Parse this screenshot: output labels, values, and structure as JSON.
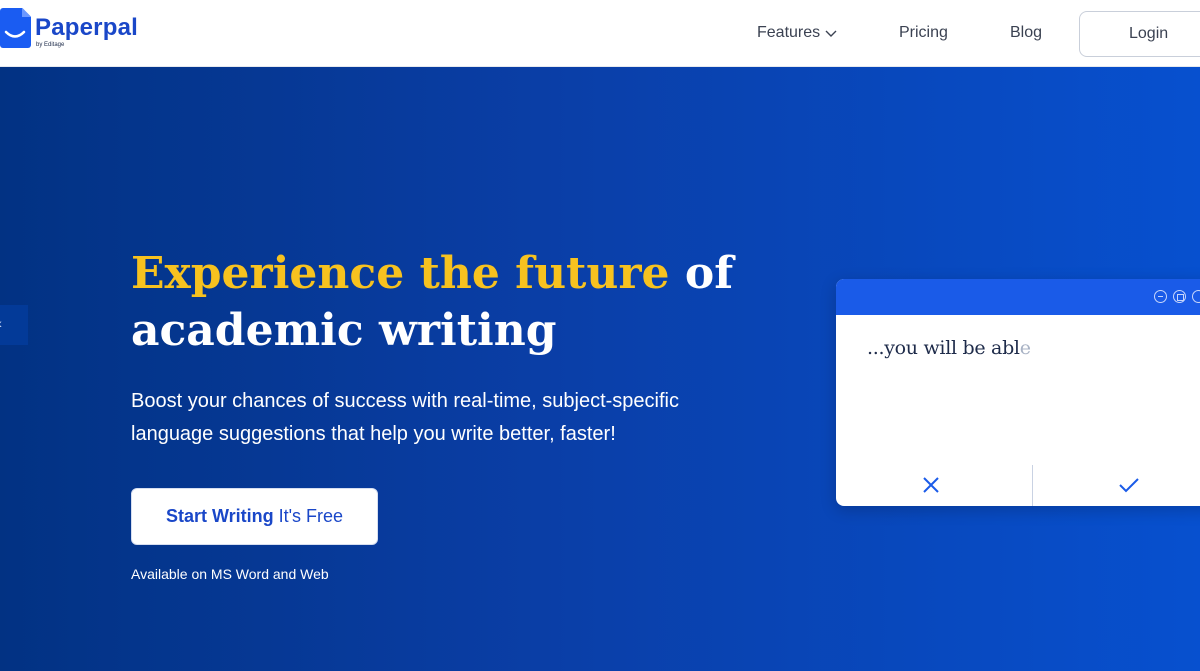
{
  "brand": {
    "name": "Paperpal",
    "tagline": "by Editage",
    "color": "#1a5cf2"
  },
  "nav": {
    "features": "Features",
    "pricing": "Pricing",
    "blog": "Blog",
    "login": "Login"
  },
  "hero": {
    "headline_highlight": "Experience the future",
    "headline_rest": " of academic writing",
    "subtext": "Boost your chances of success with real-time, subject-specific language suggestions that help you write better, faster!",
    "cta_bold": "Start Writing",
    "cta_free": "It's Free",
    "availability": "Available on MS Word and Web",
    "highlight_color": "#f7c21f"
  },
  "editor_card": {
    "typed_text": "...you will be abl",
    "ghost_text": "e",
    "reject_icon": "x-icon",
    "accept_icon": "check-icon"
  }
}
